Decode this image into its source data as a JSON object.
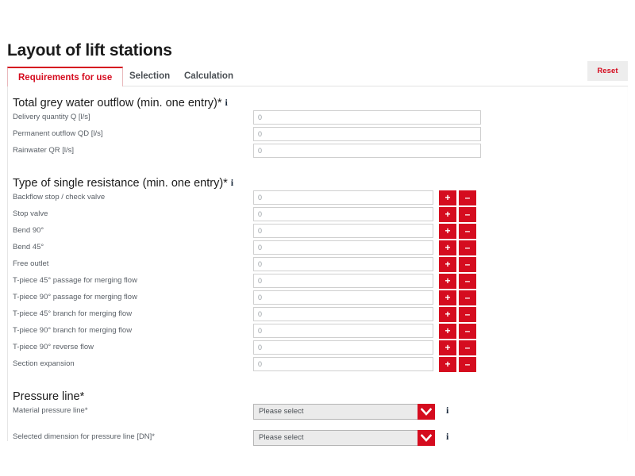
{
  "header": {
    "title": "Layout of lift stations",
    "reset_label": "Reset"
  },
  "tabs": [
    {
      "label": "Requirements for use",
      "active": true
    },
    {
      "label": "Selection",
      "active": false
    },
    {
      "label": "Calculation",
      "active": false
    }
  ],
  "colors": {
    "accent_red": "#d50c1f",
    "panel_border": "#e6e6e6",
    "label_text": "#5a6067",
    "heading_text": "#1b1b1b",
    "select_bg": "#ebebeb",
    "reset_bg": "#ededed"
  },
  "icons": {
    "info": "i",
    "plus": "+",
    "minus": "–",
    "chevron_down": "chevron-down-icon"
  },
  "sections": [
    {
      "id": "grey-water-outflow",
      "title": "Total grey water outflow (min. one entry)*",
      "has_info": true,
      "field_style": "wide",
      "rows": [
        {
          "label": "Delivery quantity Q [l/s]",
          "value": "0",
          "placeholder": "0",
          "stepper": false
        },
        {
          "label": "Permanent outflow QD [l/s]",
          "value": "0",
          "placeholder": "0",
          "stepper": false
        },
        {
          "label": "Rainwater QR [l/s]",
          "value": "0",
          "placeholder": "0",
          "stepper": false
        }
      ]
    },
    {
      "id": "single-resistance",
      "title": "Type of single resistance (min. one entry)*",
      "has_info": true,
      "field_style": "narrow",
      "rows": [
        {
          "label": "Backflow stop / check valve",
          "value": "0",
          "placeholder": "0",
          "stepper": true
        },
        {
          "label": "Stop valve",
          "value": "0",
          "placeholder": "0",
          "stepper": true
        },
        {
          "label": "Bend 90°",
          "value": "0",
          "placeholder": "0",
          "stepper": true
        },
        {
          "label": "Bend 45°",
          "value": "0",
          "placeholder": "0",
          "stepper": true
        },
        {
          "label": "Free outlet",
          "value": "0",
          "placeholder": "0",
          "stepper": true
        },
        {
          "label": "T-piece 45° passage for merging flow",
          "value": "0",
          "placeholder": "0",
          "stepper": true
        },
        {
          "label": "T-piece 90° passage for merging flow",
          "value": "0",
          "placeholder": "0",
          "stepper": true
        },
        {
          "label": "T-piece 45° branch for merging flow",
          "value": "0",
          "placeholder": "0",
          "stepper": true
        },
        {
          "label": "T-piece 90° branch for merging flow",
          "value": "0",
          "placeholder": "0",
          "stepper": true
        },
        {
          "label": "T-piece 90° reverse flow",
          "value": "0",
          "placeholder": "0",
          "stepper": true
        },
        {
          "label": "Section expansion",
          "value": "0",
          "placeholder": "0",
          "stepper": true
        }
      ]
    },
    {
      "id": "pressure-line",
      "title": "Pressure line*",
      "has_info": false,
      "field_style": "select",
      "rows": [
        {
          "label": "Material pressure line*",
          "value": "Please select",
          "has_info": true
        },
        {
          "label": "Selected dimension for pressure line [DN]*",
          "value": "Please select",
          "has_info": true
        }
      ]
    }
  ]
}
